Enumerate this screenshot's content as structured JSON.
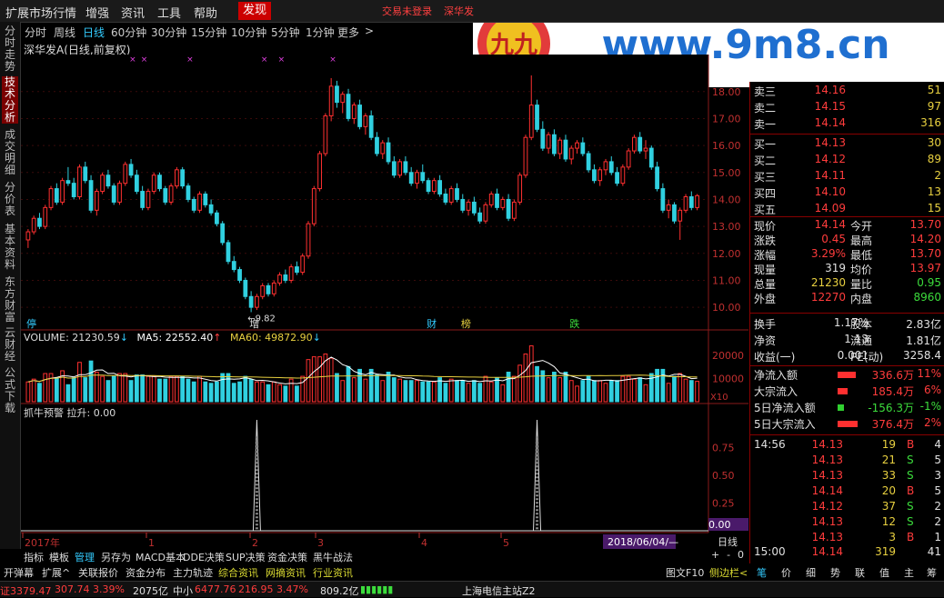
{
  "menu": [
    "扩展市场行情",
    "增强",
    "资讯",
    "工具",
    "帮助",
    "发现"
  ],
  "menu_active": "发现",
  "menu_right": [
    "交易未登录",
    "深华发"
  ],
  "watermark": {
    "text": "www.9m8.cn",
    "logo_text": "九九"
  },
  "left_tabs": [
    "分时走势",
    "技术分析",
    "成交明细",
    "分价表",
    "基本资料",
    "东方财富",
    "云财经",
    "公式下载"
  ],
  "left_tab_active": "技术分析",
  "periods": [
    "分时",
    "周线",
    "日线",
    "60分钟",
    "30分钟",
    "15分钟",
    "10分钟",
    "5分钟",
    "1分钟",
    "更多"
  ],
  "period_active": "日线",
  "more_arrow": ">",
  "stock_title": "深华发A(日线,前复权)",
  "price_axis": [
    "18.00",
    "17.00",
    "16.00",
    "15.00",
    "14.00",
    "13.00",
    "12.00",
    "11.00",
    "10.00"
  ],
  "low_label": "9.82",
  "event_tags": [
    {
      "text": "停",
      "color": "#3cf"
    },
    {
      "text": "增",
      "color": "#e0e0e0"
    },
    {
      "text": "财",
      "color": "#3cf"
    },
    {
      "text": "榜",
      "color": "#e8d040"
    },
    {
      "text": "跌",
      "color": "#3cdc3c"
    }
  ],
  "volume": {
    "label": "VOLUME:",
    "value": "21230.59",
    "ma5_label": "MA5:",
    "ma5": "22552.40",
    "ma60_label": "MA60:",
    "ma60": "49872.90"
  },
  "vol_axis": [
    "20000",
    "10000",
    "X10"
  ],
  "indicator": {
    "name": "抓牛预警",
    "field": "拉升:",
    "value": "0.00"
  },
  "ind_axis": [
    "0.75",
    "0.50",
    "0.25",
    "0.00"
  ],
  "time_axis": [
    {
      "label": "2017年",
      "color": "#c03030"
    },
    {
      "label": "1",
      "color": "#c03030"
    },
    {
      "label": "2",
      "color": "#c03030"
    },
    {
      "label": "3",
      "color": "#c03030"
    },
    {
      "label": "4",
      "color": "#c03030"
    },
    {
      "label": "5",
      "color": "#c03030"
    }
  ],
  "cursor_date": "2018/06/04/—",
  "day_box": {
    "label": "日线",
    "plus": "+",
    "minus": "-",
    "zero": "0"
  },
  "bottom_tabs": [
    "指标",
    "模板",
    "管理",
    "另存为",
    "MACD基本",
    "DDE决策",
    "SUP决策",
    "资金决策",
    "黑牛战法"
  ],
  "bottom_tab_active": "管理",
  "bottom_tabs2": [
    {
      "text": "开弹幕",
      "yellow": false
    },
    {
      "text": "扩展^",
      "yellow": false
    },
    {
      "text": "关联报价",
      "yellow": false
    },
    {
      "text": "资金分布",
      "yellow": false
    },
    {
      "text": "主力轨迹",
      "yellow": false
    },
    {
      "text": "综合资讯",
      "yellow": true
    },
    {
      "text": "网摘资讯",
      "yellow": true
    },
    {
      "text": "行业资讯",
      "yellow": true
    }
  ],
  "bottom_right": [
    "图文F10",
    "侧边栏<"
  ],
  "status": {
    "idx1": "证3379.47",
    "chg1": "307.74",
    "pct1": "3.39%",
    "amt1": "2075亿",
    "idx2_label": "中小",
    "idx2": "6477.76",
    "chg2": "216.95",
    "pct2": "3.47%",
    "amt2": "809.2亿",
    "server": "上海电信主站Z2"
  },
  "order_book": [
    {
      "label": "卖三",
      "price": "14.16",
      "vol": "51"
    },
    {
      "label": "卖二",
      "price": "14.15",
      "vol": "97"
    },
    {
      "label": "卖一",
      "price": "14.14",
      "vol": "316"
    },
    {
      "label": "买一",
      "price": "14.13",
      "vol": "30"
    },
    {
      "label": "买二",
      "price": "14.12",
      "vol": "89"
    },
    {
      "label": "买三",
      "price": "14.11",
      "vol": "2"
    },
    {
      "label": "买四",
      "price": "14.10",
      "vol": "13"
    },
    {
      "label": "买五",
      "price": "14.09",
      "vol": "15"
    }
  ],
  "quote": [
    {
      "l1": "现价",
      "v1": "14.14",
      "c1": "red",
      "l2": "今开",
      "v2": "13.70",
      "c2": "red"
    },
    {
      "l1": "涨跌",
      "v1": "0.45",
      "c1": "red",
      "l2": "最高",
      "v2": "14.20",
      "c2": "red"
    },
    {
      "l1": "涨幅",
      "v1": "3.29%",
      "c1": "red",
      "l2": "最低",
      "v2": "13.70",
      "c2": "red"
    },
    {
      "l1": "现量",
      "v1": "319",
      "c1": "white",
      "l2": "均价",
      "v2": "13.97",
      "c2": "red"
    },
    {
      "l1": "总量",
      "v1": "21230",
      "c1": "yellow",
      "l2": "量比",
      "v2": "0.95",
      "c2": "green"
    },
    {
      "l1": "外盘",
      "v1": "12270",
      "c1": "red",
      "l2": "内盘",
      "v2": "8960",
      "c2": "green"
    }
  ],
  "fundamentals": [
    {
      "l1": "换手",
      "v1": "1.17%",
      "c1": "white",
      "l2": "股本",
      "v2": "2.83亿",
      "c2": "white"
    },
    {
      "l1": "净资",
      "v1": "1.13",
      "c1": "white",
      "l2": "流通",
      "v2": "1.81亿",
      "c2": "white"
    },
    {
      "l1": "收益(一)",
      "v1": "0.001",
      "c1": "white",
      "l2": "PE(动)",
      "v2": "3258.4",
      "c2": "white"
    }
  ],
  "flows": [
    {
      "label": "净流入额",
      "value": "336.6万",
      "pct": "11%",
      "color": "red",
      "bar": 0.9
    },
    {
      "label": "大宗流入",
      "value": "185.4万",
      "pct": "6%",
      "color": "red",
      "bar": 0.5
    },
    {
      "label": "5日净流入额",
      "value": "-156.3万",
      "pct": "-1%",
      "color": "green",
      "bar": 0.3
    },
    {
      "label": "5日大宗流入",
      "value": "376.4万",
      "pct": "2%",
      "color": "red",
      "bar": 1.0
    }
  ],
  "ticks_time": "14:56",
  "ticks": [
    {
      "price": "14.13",
      "vol": "19",
      "side": "B",
      "n": "4"
    },
    {
      "price": "14.13",
      "vol": "21",
      "side": "S",
      "n": "5"
    },
    {
      "price": "14.13",
      "vol": "33",
      "side": "S",
      "n": "3"
    },
    {
      "price": "14.14",
      "vol": "20",
      "side": "B",
      "n": "5"
    },
    {
      "price": "14.12",
      "vol": "37",
      "side": "S",
      "n": "2"
    },
    {
      "price": "14.13",
      "vol": "12",
      "side": "S",
      "n": "2"
    },
    {
      "price": "14.13",
      "vol": "3",
      "side": "B",
      "n": "1"
    }
  ],
  "last_tick": {
    "time": "15:00",
    "price": "14.14",
    "vol": "319",
    "n": "41"
  },
  "right_tabs": [
    "笔",
    "价",
    "细",
    "势",
    "联",
    "值",
    "主",
    "筹"
  ],
  "right_tab_active": "笔",
  "chart_data": {
    "type": "candlestick",
    "price_range": [
      9.6,
      18.7
    ],
    "candles": [
      [
        12.5,
        12.9,
        12.2,
        12.8
      ],
      [
        12.8,
        13.4,
        12.7,
        13.3
      ],
      [
        13.3,
        13.5,
        12.9,
        13.0
      ],
      [
        13.0,
        13.8,
        12.9,
        13.7
      ],
      [
        13.7,
        14.5,
        13.6,
        14.4
      ],
      [
        14.4,
        14.6,
        13.8,
        13.9
      ],
      [
        13.9,
        14.8,
        13.8,
        14.7
      ],
      [
        14.7,
        15.2,
        14.5,
        14.6
      ],
      [
        14.6,
        14.8,
        14.0,
        14.1
      ],
      [
        14.1,
        15.3,
        14.0,
        15.2
      ],
      [
        15.2,
        15.4,
        14.6,
        14.7
      ],
      [
        14.7,
        14.9,
        13.5,
        13.6
      ],
      [
        13.6,
        14.4,
        13.4,
        14.3
      ],
      [
        14.3,
        15.0,
        14.2,
        14.9
      ],
      [
        14.9,
        15.1,
        14.4,
        14.5
      ],
      [
        14.5,
        14.6,
        13.8,
        13.9
      ],
      [
        13.9,
        14.7,
        13.8,
        14.6
      ],
      [
        14.6,
        15.4,
        14.5,
        15.3
      ],
      [
        15.3,
        15.5,
        14.8,
        14.9
      ],
      [
        14.9,
        15.1,
        14.2,
        14.3
      ],
      [
        14.3,
        14.5,
        13.6,
        13.7
      ],
      [
        13.7,
        14.4,
        13.6,
        14.3
      ],
      [
        14.3,
        15.0,
        14.2,
        14.9
      ],
      [
        14.9,
        15.0,
        14.3,
        14.4
      ],
      [
        14.4,
        14.5,
        13.8,
        13.9
      ],
      [
        13.9,
        14.6,
        13.8,
        14.5
      ],
      [
        14.5,
        15.2,
        14.4,
        15.1
      ],
      [
        15.1,
        15.2,
        14.4,
        14.5
      ],
      [
        14.5,
        14.6,
        13.9,
        14.0
      ],
      [
        14.0,
        14.1,
        13.5,
        13.6
      ],
      [
        13.6,
        14.3,
        13.5,
        14.2
      ],
      [
        14.2,
        14.3,
        13.7,
        13.8
      ],
      [
        13.8,
        14.0,
        13.4,
        13.5
      ],
      [
        13.5,
        13.6,
        13.0,
        13.1
      ],
      [
        13.1,
        13.2,
        12.3,
        12.4
      ],
      [
        12.4,
        12.5,
        11.6,
        11.7
      ],
      [
        11.7,
        11.9,
        11.3,
        11.4
      ],
      [
        11.4,
        11.5,
        10.9,
        11.0
      ],
      [
        11.0,
        11.1,
        10.3,
        10.4
      ],
      [
        10.4,
        10.6,
        9.82,
        10.0
      ],
      [
        10.0,
        10.5,
        9.9,
        10.4
      ],
      [
        10.4,
        10.9,
        10.3,
        10.8
      ],
      [
        10.8,
        10.9,
        10.4,
        10.5
      ],
      [
        10.5,
        11.0,
        10.4,
        10.9
      ],
      [
        10.9,
        11.3,
        10.8,
        11.2
      ],
      [
        11.2,
        11.4,
        10.9,
        11.0
      ],
      [
        11.0,
        11.6,
        10.9,
        11.5
      ],
      [
        11.5,
        11.7,
        11.2,
        11.3
      ],
      [
        11.3,
        12.0,
        11.2,
        11.9
      ],
      [
        11.9,
        13.2,
        11.8,
        13.1
      ],
      [
        13.1,
        14.5,
        13.0,
        14.4
      ],
      [
        14.4,
        15.8,
        14.3,
        15.7
      ],
      [
        15.7,
        17.2,
        15.6,
        17.1
      ],
      [
        17.1,
        18.5,
        16.9,
        18.2
      ],
      [
        18.2,
        18.4,
        17.4,
        17.6
      ],
      [
        17.6,
        18.0,
        17.2,
        17.9
      ],
      [
        17.9,
        18.1,
        16.9,
        17.0
      ],
      [
        17.0,
        17.6,
        16.8,
        17.5
      ],
      [
        17.5,
        17.7,
        16.6,
        16.7
      ],
      [
        16.7,
        17.2,
        16.4,
        17.1
      ],
      [
        17.1,
        17.3,
        16.2,
        16.3
      ],
      [
        16.3,
        16.5,
        15.6,
        15.7
      ],
      [
        15.7,
        16.2,
        15.5,
        16.1
      ],
      [
        16.1,
        16.3,
        15.3,
        15.4
      ],
      [
        15.4,
        15.6,
        14.8,
        14.9
      ],
      [
        14.9,
        15.5,
        14.8,
        15.4
      ],
      [
        15.4,
        15.6,
        14.9,
        15.0
      ],
      [
        15.0,
        15.2,
        14.5,
        14.6
      ],
      [
        14.6,
        15.1,
        14.4,
        15.0
      ],
      [
        15.0,
        15.3,
        14.6,
        14.7
      ],
      [
        14.7,
        14.8,
        14.2,
        14.3
      ],
      [
        14.3,
        14.8,
        14.2,
        14.7
      ],
      [
        14.7,
        14.9,
        14.1,
        14.2
      ],
      [
        14.2,
        14.4,
        13.8,
        13.9
      ],
      [
        13.9,
        14.5,
        13.8,
        14.4
      ],
      [
        14.4,
        14.6,
        13.9,
        14.0
      ],
      [
        14.0,
        14.2,
        13.5,
        13.6
      ],
      [
        13.6,
        14.0,
        13.4,
        13.9
      ],
      [
        13.9,
        14.1,
        13.4,
        13.5
      ],
      [
        13.5,
        13.7,
        13.1,
        13.2
      ],
      [
        13.2,
        13.9,
        13.1,
        13.8
      ],
      [
        13.8,
        14.3,
        13.7,
        14.2
      ],
      [
        14.2,
        14.4,
        13.6,
        13.7
      ],
      [
        13.7,
        14.1,
        13.6,
        14.0
      ],
      [
        14.0,
        14.2,
        13.2,
        13.3
      ],
      [
        13.3,
        14.0,
        13.2,
        13.9
      ],
      [
        13.9,
        15.0,
        13.8,
        14.9
      ],
      [
        14.9,
        16.4,
        14.8,
        16.3
      ],
      [
        16.3,
        18.6,
        16.2,
        17.5
      ],
      [
        17.5,
        17.7,
        16.5,
        16.6
      ],
      [
        16.6,
        16.9,
        15.8,
        15.9
      ],
      [
        15.9,
        16.5,
        15.7,
        16.4
      ],
      [
        16.4,
        16.6,
        15.6,
        15.7
      ],
      [
        15.7,
        16.3,
        15.5,
        16.2
      ],
      [
        16.2,
        16.4,
        15.4,
        15.5
      ],
      [
        15.5,
        16.0,
        15.3,
        15.9
      ],
      [
        15.9,
        16.2,
        15.7,
        16.1
      ],
      [
        16.1,
        16.3,
        15.6,
        15.7
      ],
      [
        15.7,
        15.8,
        15.0,
        15.1
      ],
      [
        15.1,
        15.3,
        14.6,
        14.7
      ],
      [
        14.7,
        15.2,
        14.5,
        15.1
      ],
      [
        15.1,
        15.5,
        14.9,
        15.4
      ],
      [
        15.4,
        15.6,
        14.9,
        15.0
      ],
      [
        15.0,
        15.2,
        14.5,
        14.6
      ],
      [
        14.6,
        15.3,
        14.5,
        15.2
      ],
      [
        15.2,
        15.9,
        15.1,
        15.8
      ],
      [
        15.8,
        16.4,
        15.7,
        16.3
      ],
      [
        16.3,
        16.5,
        15.7,
        15.8
      ],
      [
        15.8,
        16.2,
        15.5,
        15.9
      ],
      [
        15.9,
        16.0,
        15.1,
        15.2
      ],
      [
        15.2,
        15.4,
        14.3,
        14.4
      ],
      [
        14.4,
        14.6,
        13.5,
        13.6
      ],
      [
        13.6,
        14.0,
        13.3,
        13.8
      ],
      [
        13.8,
        13.9,
        13.1,
        13.2
      ],
      [
        13.2,
        13.7,
        12.5,
        13.6
      ],
      [
        13.6,
        14.2,
        13.5,
        14.1
      ],
      [
        14.1,
        14.3,
        13.6,
        13.7
      ],
      [
        13.7,
        14.2,
        13.6,
        14.14
      ]
    ],
    "volume_range": [
      0,
      25000
    ],
    "indicator_spikes_at": [
      40,
      89
    ],
    "indicator_range": [
      0,
      1
    ]
  }
}
